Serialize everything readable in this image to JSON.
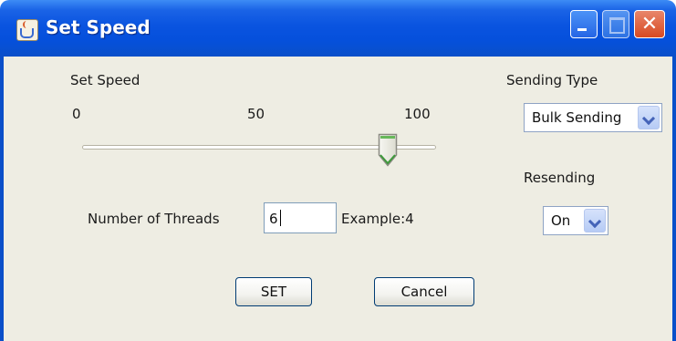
{
  "window": {
    "title": "Set Speed",
    "accent_color": "#0a54e0",
    "background_color": "#eeede3"
  },
  "titlebar_buttons": {
    "minimize_icon": "minimize-icon",
    "maximize_icon": "maximize-icon",
    "close_icon": "close-icon",
    "close_glyph": "✕"
  },
  "speed": {
    "label": "Set Speed",
    "tick_labels": [
      "0",
      "50",
      "100"
    ],
    "value": 87,
    "min": 0,
    "max": 100
  },
  "sending_type": {
    "label": "Sending Type",
    "selected": "Bulk Sending"
  },
  "resending": {
    "label": "Resending",
    "selected": "On"
  },
  "threads": {
    "label": "Number of Threads",
    "value": "6",
    "example": "Example:4"
  },
  "actions": {
    "set_label": "SET",
    "cancel_label": "Cancel"
  }
}
